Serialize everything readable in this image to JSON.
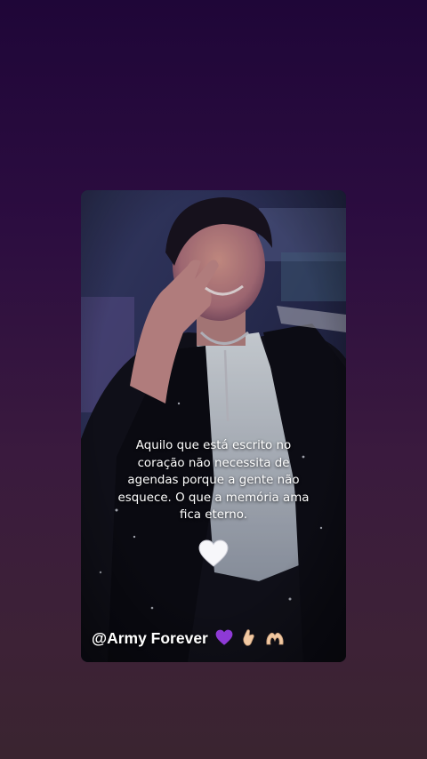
{
  "card": {
    "photo_icon": "smiling-person-photo",
    "quote": "Aquilo que está escrito no coração não necessita de agendas porque a gente não esquece. O que a memória ama fica eterno.",
    "heart_icon": "white-heart-icon",
    "handle": {
      "text": "@Army Forever",
      "emojis": [
        "purple-heart-icon",
        "finger-heart-icon",
        "heart-hands-icon"
      ]
    }
  },
  "colors": {
    "background_top": "#1f0638",
    "background_bottom": "#3a2430",
    "purple_heart": "#8e3ad6",
    "skin": "#f2c9a2"
  }
}
